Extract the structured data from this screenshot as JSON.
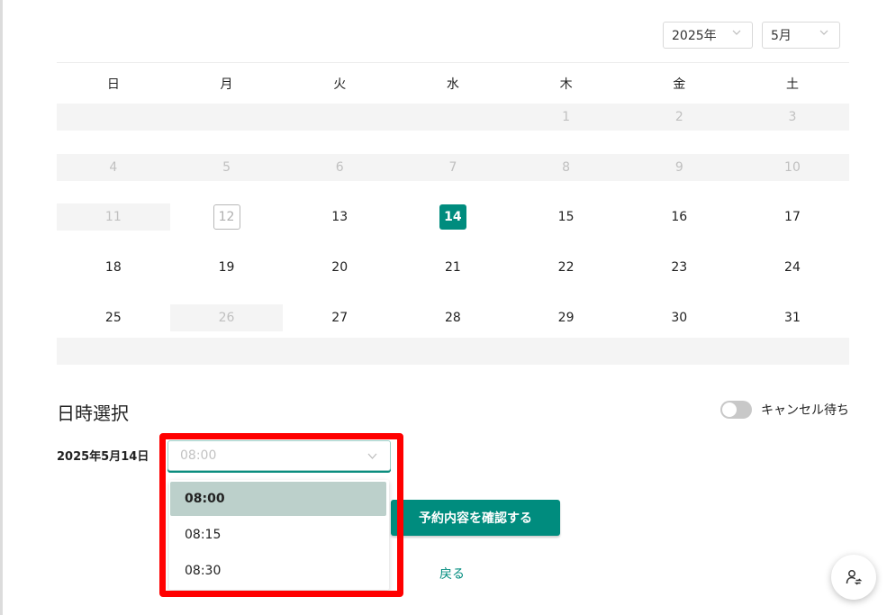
{
  "calendar": {
    "year_value": "2025年",
    "month_value": "5月",
    "weekdays": [
      "日",
      "月",
      "火",
      "水",
      "木",
      "金",
      "土"
    ],
    "weeks": [
      [
        {
          "label": "",
          "state": "gray"
        },
        {
          "label": "",
          "state": "gray"
        },
        {
          "label": "",
          "state": "gray"
        },
        {
          "label": "",
          "state": "gray"
        },
        {
          "label": "1",
          "state": "gray"
        },
        {
          "label": "2",
          "state": "gray"
        },
        {
          "label": "3",
          "state": "gray"
        }
      ],
      [
        {
          "label": "4",
          "state": "gray"
        },
        {
          "label": "5",
          "state": "gray"
        },
        {
          "label": "6",
          "state": "gray"
        },
        {
          "label": "7",
          "state": "gray"
        },
        {
          "label": "8",
          "state": "gray"
        },
        {
          "label": "9",
          "state": "gray"
        },
        {
          "label": "10",
          "state": "gray"
        }
      ],
      [
        {
          "label": "11",
          "state": "gray"
        },
        {
          "label": "12",
          "state": "today"
        },
        {
          "label": "13",
          "state": "available"
        },
        {
          "label": "14",
          "state": "selected"
        },
        {
          "label": "15",
          "state": "available"
        },
        {
          "label": "16",
          "state": "available"
        },
        {
          "label": "17",
          "state": "available"
        }
      ],
      [
        {
          "label": "18",
          "state": "available"
        },
        {
          "label": "19",
          "state": "available"
        },
        {
          "label": "20",
          "state": "available"
        },
        {
          "label": "21",
          "state": "available"
        },
        {
          "label": "22",
          "state": "available"
        },
        {
          "label": "23",
          "state": "available"
        },
        {
          "label": "24",
          "state": "available"
        }
      ],
      [
        {
          "label": "25",
          "state": "available"
        },
        {
          "label": "26",
          "state": "gray"
        },
        {
          "label": "27",
          "state": "available"
        },
        {
          "label": "28",
          "state": "available"
        },
        {
          "label": "29",
          "state": "available"
        },
        {
          "label": "30",
          "state": "available"
        },
        {
          "label": "31",
          "state": "available"
        }
      ]
    ]
  },
  "datetime_section": {
    "title": "日時選択",
    "cancel_wait_label": "キャンセル待ち",
    "cancel_wait_on": false,
    "selected_date": "2025年5月14日",
    "time_placeholder": "08:00",
    "time_options": [
      "08:00",
      "08:15",
      "08:30"
    ],
    "active_option": "08:00"
  },
  "actions": {
    "confirm_label": "予約内容を確認する",
    "back_label": "戻る"
  },
  "colors": {
    "accent": "#008c7e",
    "highlight": "#ff0000",
    "option_active": "#bcd0cb"
  },
  "icons": {
    "fab": "user-switch-icon",
    "dropdown": "chevron-down-icon"
  }
}
